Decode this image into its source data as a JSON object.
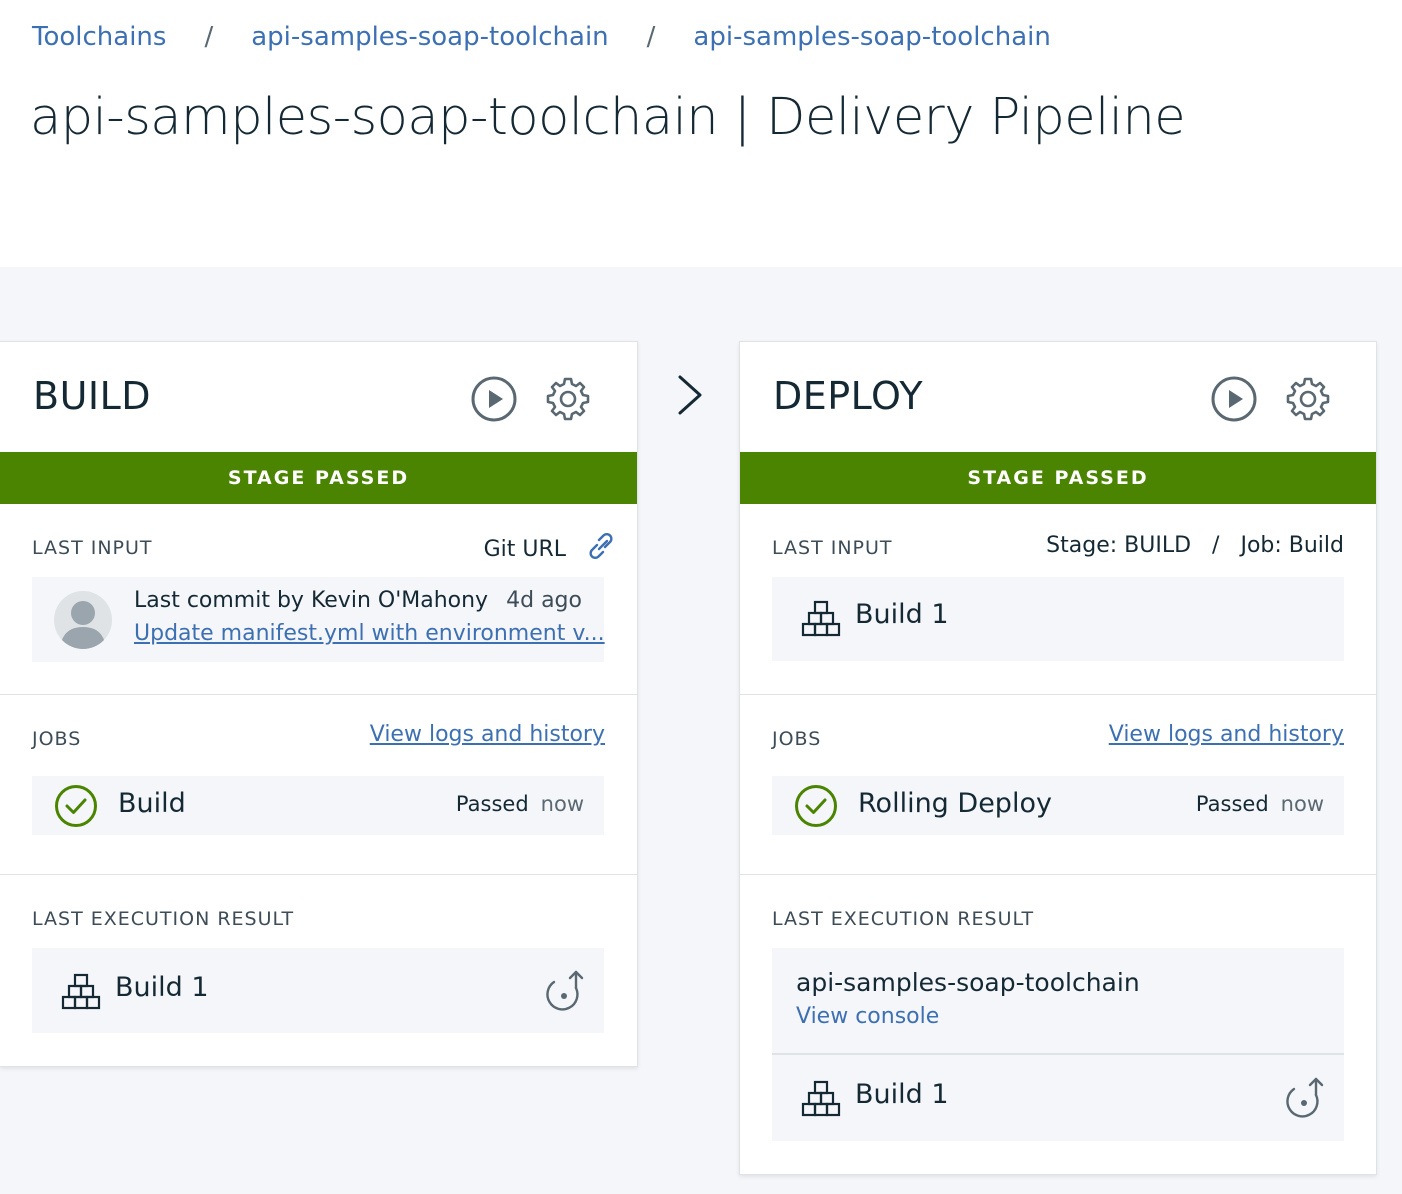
{
  "breadcrumb": {
    "items": [
      "Toolchains",
      "api-samples-soap-toolchain",
      "api-samples-soap-toolchain"
    ],
    "separator": "/"
  },
  "page_title": "api-samples-soap-toolchain | Delivery Pipeline",
  "colors": {
    "passed_green": "#4b8400",
    "link_blue": "#3d70b2",
    "canvas_bg": "#f4f6f9"
  },
  "stages": [
    {
      "name": "BUILD",
      "status": "STAGE PASSED",
      "last_input": {
        "label": "LAST INPUT",
        "right_label": "Git URL",
        "commit_by": "Last commit by Kevin O'Mahony",
        "commit_time": "4d ago",
        "commit_message": "Update manifest.yml with environment v..."
      },
      "jobs": {
        "label": "JOBS",
        "link": "View logs and history",
        "items": [
          {
            "name": "Build",
            "status": "Passed",
            "time": "now"
          }
        ]
      },
      "last_execution": {
        "label": "LAST EXECUTION RESULT",
        "build": "Build 1"
      }
    },
    {
      "name": "DEPLOY",
      "status": "STAGE PASSED",
      "last_input": {
        "label": "LAST INPUT",
        "stage_ref": "Stage: BUILD",
        "separator": "/",
        "job_ref": "Job: Build",
        "build": "Build 1"
      },
      "jobs": {
        "label": "JOBS",
        "link": "View logs and history",
        "items": [
          {
            "name": "Rolling Deploy",
            "status": "Passed",
            "time": "now"
          }
        ]
      },
      "last_execution": {
        "label": "LAST EXECUTION RESULT",
        "app_name": "api-samples-soap-toolchain",
        "console_link": "View console",
        "build": "Build 1"
      }
    }
  ],
  "icons": {
    "play": "play-icon",
    "gear": "gear-icon",
    "link": "link-icon",
    "avatar": "avatar",
    "check": "checkmark-icon",
    "build": "build-blocks-icon",
    "redeploy": "redeploy-icon",
    "arrow": "chevron-right-icon"
  }
}
